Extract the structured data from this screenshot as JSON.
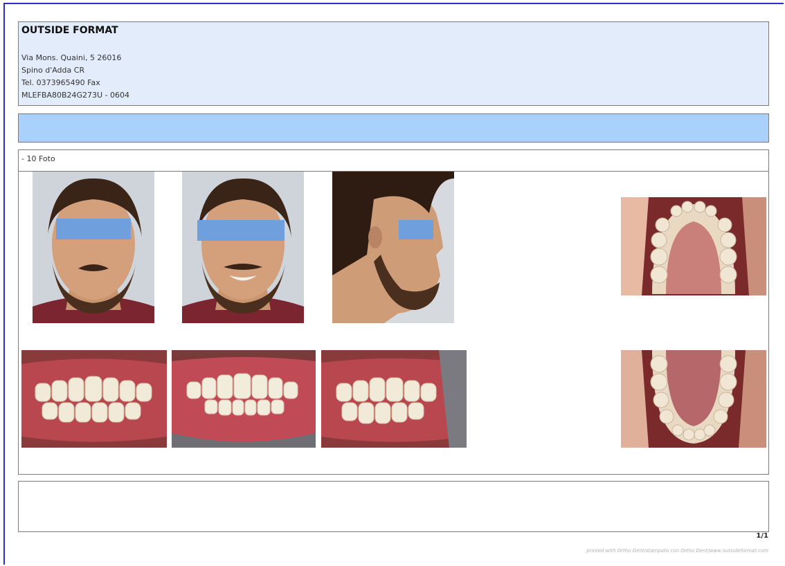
{
  "header": {
    "company": "OUTSIDE FORMAT",
    "address_lines": [
      "Via Mons. Quaini, 5 26016",
      "Spino d'Adda CR",
      "Tel. 0373965490 Fax",
      "MLEFBA80B24G273U  - 0604"
    ]
  },
  "section": {
    "title": "- 10 Foto"
  },
  "photos": [
    {
      "icon": "face-frontal-photo-icon"
    },
    {
      "icon": "face-smile-photo-icon"
    },
    {
      "icon": "face-profile-photo-icon"
    },
    {
      "icon": "upper-occlusal-photo-icon"
    },
    {
      "icon": "intraoral-right-photo-icon"
    },
    {
      "icon": "intraoral-frontal-photo-icon"
    },
    {
      "icon": "intraoral-left-photo-icon"
    },
    {
      "icon": "lower-occlusal-photo-icon"
    }
  ],
  "footer": {
    "page": "1/1",
    "printed": "printed with Ortho Dent/stampato con Ortho Dent/www.outsideformat.com"
  },
  "colors": {
    "header_bg": "#e3ecfb",
    "bar_bg": "#a9d1fb",
    "privacy_bar": "#6f9fdc",
    "frame": "#2a2ad6"
  }
}
